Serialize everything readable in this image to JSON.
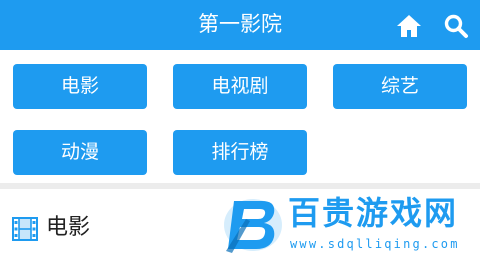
{
  "header": {
    "title": "第一影院",
    "home_icon": "home-icon",
    "search_icon": "search-icon",
    "background": "#1e9bf0"
  },
  "nav": {
    "items": [
      {
        "label": "电影"
      },
      {
        "label": "电视剧"
      },
      {
        "label": "综艺"
      },
      {
        "label": "动漫"
      },
      {
        "label": "排行榜"
      }
    ]
  },
  "section": {
    "title": "电影",
    "icon": "film-icon"
  },
  "watermark": {
    "name": "百贵游戏网",
    "url": "www.sdqlliqing.com"
  },
  "colors": {
    "accent": "#1e9bf0",
    "text": "#222222",
    "divider": "#ececec"
  }
}
